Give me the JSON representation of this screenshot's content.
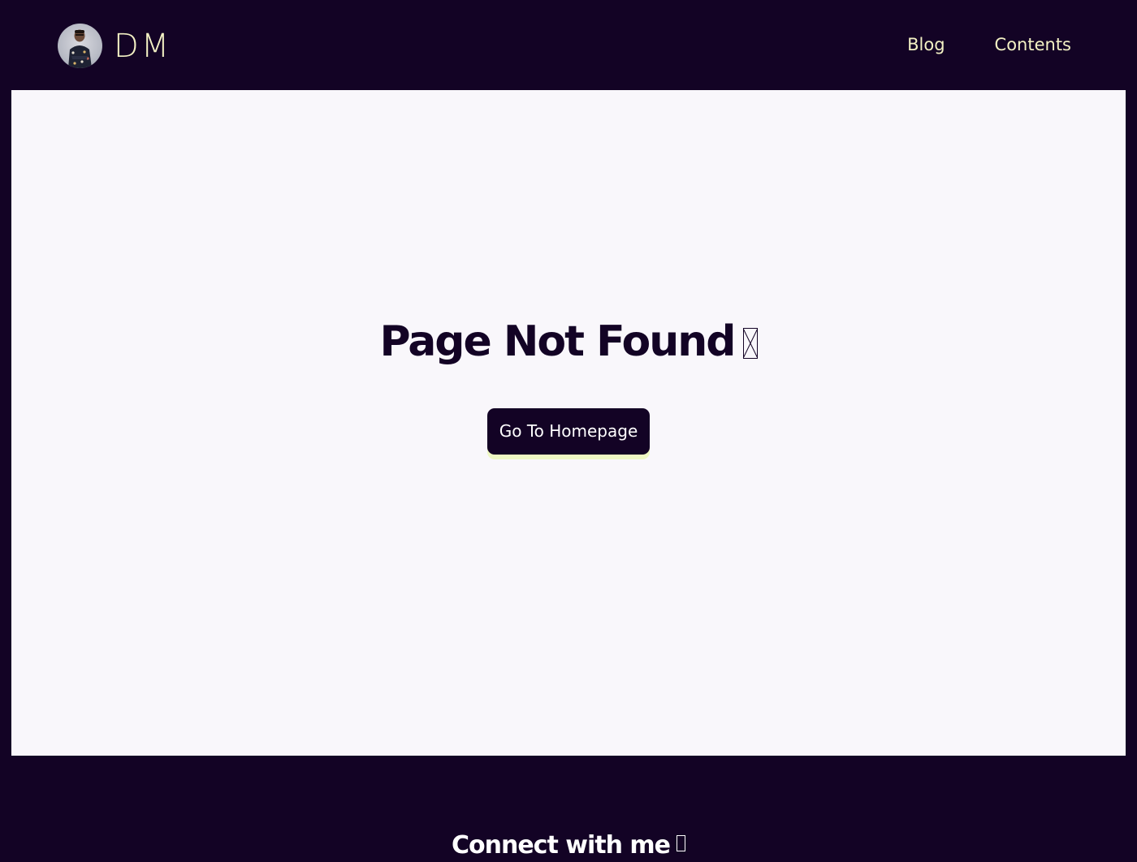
{
  "header": {
    "brand_name": "DM",
    "avatar_alt": "profile photo",
    "nav": [
      {
        "label": "Blog"
      },
      {
        "label": "Contents"
      }
    ]
  },
  "main": {
    "title": "Page Not Found",
    "title_emoji_icon": "missing-glyph-icon",
    "button_label": "Go To Homepage"
  },
  "footer": {
    "title": "Connect with me",
    "title_emoji_icon": "missing-glyph-icon"
  },
  "colors": {
    "background": "#130325",
    "accent_text": "#f3f1c4",
    "content_bg": "#f9f7fb",
    "button_shadow": "#eef7c3"
  }
}
